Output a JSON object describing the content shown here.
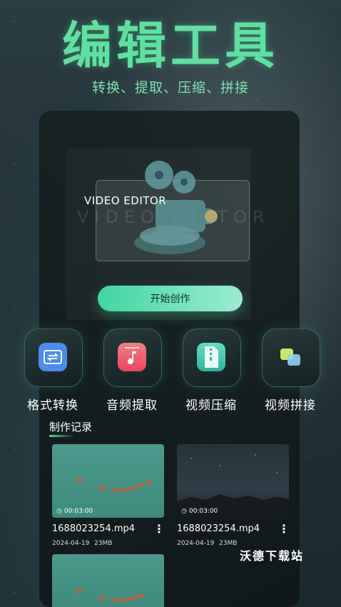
{
  "header": {
    "title": "编辑工具",
    "subtitle": "转换、提取、压缩、拼接"
  },
  "banner": {
    "label": "VIDEO EDITOR",
    "ghost_label": "VIDEO EDITOR",
    "start_button": "开始创作"
  },
  "tools": [
    {
      "label": "格式转换",
      "icon": "format-convert-icon",
      "color": "#4a8cf0"
    },
    {
      "label": "音频提取",
      "icon": "audio-extract-icon",
      "color": "#f05a6a"
    },
    {
      "label": "视频压缩",
      "icon": "video-compress-icon",
      "color": "#3fc9b0"
    },
    {
      "label": "视频拼接",
      "icon": "video-merge-icon",
      "color": "#d9e96a"
    }
  ],
  "records": {
    "title": "制作记录",
    "items": [
      {
        "duration": "00:03:00",
        "name": "1688023254.mp4",
        "date": "2024-04-19",
        "size": "23MB"
      },
      {
        "duration": "00:03:00",
        "name": "1688023254.mp4",
        "date": "2024-04-19",
        "size": "23MB"
      }
    ]
  },
  "watermark": "沃德下载站",
  "accent_color": "#4fe0a8"
}
